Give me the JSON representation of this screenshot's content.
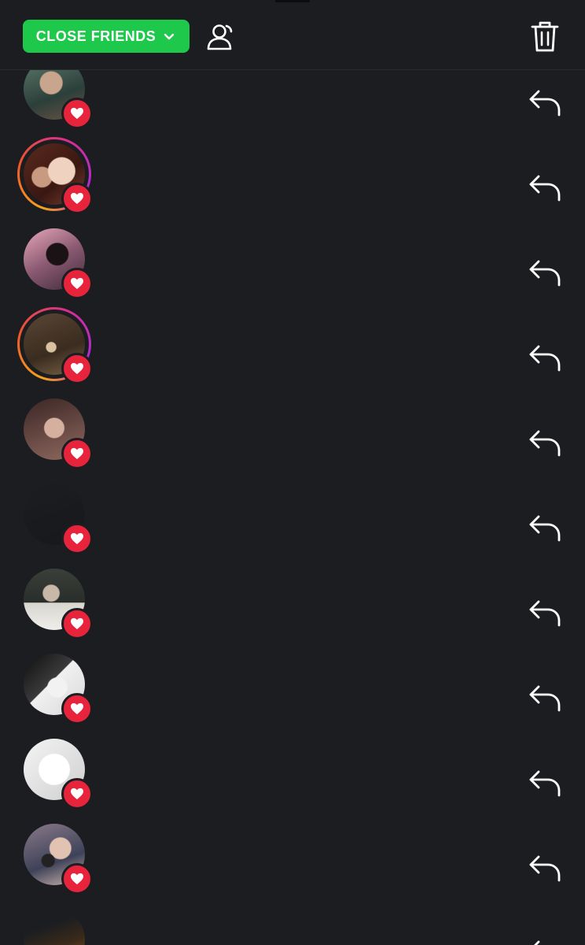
{
  "header": {
    "audience_label": "CLOSE FRIENDS",
    "audience_icon": "chevron-down-icon",
    "viewers_icon": "viewers-icon",
    "delete_icon": "trash-icon"
  },
  "colors": {
    "background": "#1b1d21",
    "close_friends_green": "#1ec84a",
    "heart_red": "#e8243c",
    "story_ring": [
      "#f7a21b",
      "#f0542c",
      "#d62f8f",
      "#b02bcf"
    ]
  },
  "viewers": [
    {
      "has_story_ring": false,
      "liked": true,
      "avatar": "a1"
    },
    {
      "has_story_ring": true,
      "liked": true,
      "avatar": "a2"
    },
    {
      "has_story_ring": false,
      "liked": true,
      "avatar": "a3"
    },
    {
      "has_story_ring": true,
      "liked": true,
      "avatar": "a4"
    },
    {
      "has_story_ring": false,
      "liked": true,
      "avatar": "a5"
    },
    {
      "has_story_ring": false,
      "liked": true,
      "avatar": "a6"
    },
    {
      "has_story_ring": false,
      "liked": true,
      "avatar": "a7"
    },
    {
      "has_story_ring": false,
      "liked": true,
      "avatar": "a8"
    },
    {
      "has_story_ring": false,
      "liked": true,
      "avatar": "a9"
    },
    {
      "has_story_ring": false,
      "liked": true,
      "avatar": "a10"
    },
    {
      "has_story_ring": false,
      "liked": true,
      "avatar": "a11"
    }
  ],
  "row_action_icon": "reply-icon",
  "liked_icon": "heart-icon"
}
